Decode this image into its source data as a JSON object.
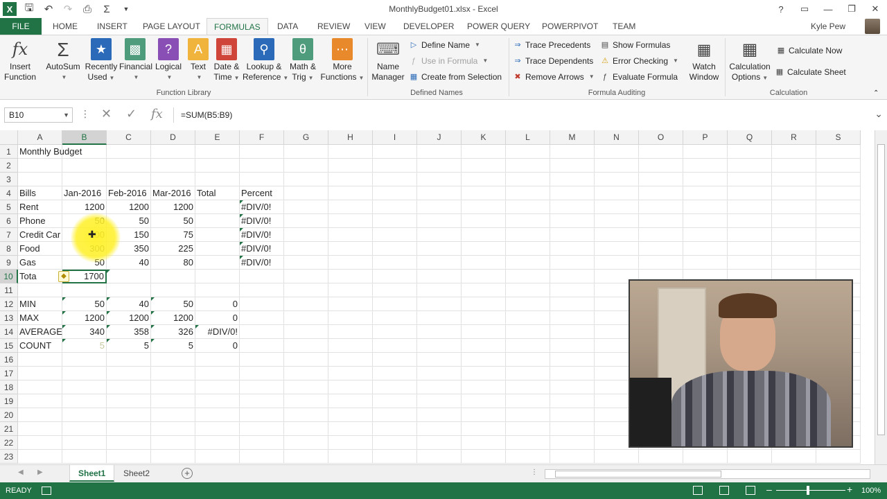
{
  "window": {
    "title": "MonthlyBudget01.xlsx - Excel",
    "app_icon": "X",
    "help_icon": "?"
  },
  "tabs": [
    {
      "label": "FILE"
    },
    {
      "label": "HOME"
    },
    {
      "label": "INSERT"
    },
    {
      "label": "PAGE LAYOUT"
    },
    {
      "label": "FORMULAS"
    },
    {
      "label": "DATA"
    },
    {
      "label": "REVIEW"
    },
    {
      "label": "VIEW"
    },
    {
      "label": "DEVELOPER"
    },
    {
      "label": "POWER QUERY"
    },
    {
      "label": "POWERPIVOT"
    },
    {
      "label": "TEAM"
    }
  ],
  "active_tab": "FORMULAS",
  "user": {
    "name": "Kyle Pew"
  },
  "ribbon": {
    "function_library": {
      "label": "Function Library",
      "insert_function": "Insert\nFunction",
      "autosum": "AutoSum",
      "recently_used_1": "Recently",
      "recently_used_2": "Used",
      "financial": "Financial",
      "logical": "Logical",
      "text": "Text",
      "date_time_1": "Date &",
      "date_time_2": "Time",
      "lookup_1": "Lookup &",
      "lookup_2": "Reference",
      "math_1": "Math &",
      "math_2": "Trig",
      "more_1": "More",
      "more_2": "Functions"
    },
    "defined_names": {
      "label": "Defined Names",
      "name_manager_1": "Name",
      "name_manager_2": "Manager",
      "define_name": "Define Name",
      "use_in_formula": "Use in Formula",
      "create_from_selection": "Create from Selection"
    },
    "formula_auditing": {
      "label": "Formula Auditing",
      "trace_precedents": "Trace Precedents",
      "trace_dependents": "Trace Dependents",
      "remove_arrows": "Remove Arrows",
      "show_formulas": "Show Formulas",
      "error_checking": "Error Checking",
      "evaluate_formula": "Evaluate Formula",
      "watch_window_1": "Watch",
      "watch_window_2": "Window"
    },
    "calculation": {
      "label": "Calculation",
      "calc_options_1": "Calculation",
      "calc_options_2": "Options",
      "calculate_now": "Calculate Now",
      "calculate_sheet": "Calculate Sheet"
    },
    "colors": {
      "accent": "#217346"
    }
  },
  "formula_bar": {
    "name_box": "B10",
    "formula": "=SUM(B5:B9)"
  },
  "columns": [
    "A",
    "B",
    "C",
    "D",
    "E",
    "F",
    "G",
    "H",
    "I",
    "J",
    "K",
    "L",
    "M",
    "N",
    "O",
    "P",
    "Q",
    "R",
    "S"
  ],
  "selected_column": "B",
  "rows": [
    "1",
    "2",
    "3",
    "4",
    "5",
    "6",
    "7",
    "8",
    "9",
    "10",
    "11",
    "12",
    "13",
    "14",
    "15",
    "16",
    "17",
    "18",
    "19",
    "20",
    "21",
    "22",
    "23"
  ],
  "selected_row": "10",
  "cells": {
    "A1": "Monthly Budget",
    "A4": "Bills",
    "B4": "Jan-2016",
    "C4": "Feb-2016",
    "D4": "Mar-2016",
    "E4": "Total",
    "F4": "Percent",
    "A5": "Rent",
    "B5": "1200",
    "C5": "1200",
    "D5": "1200",
    "F5": "#DIV/0!",
    "A6": "Phone",
    "B6": "50",
    "C6": "50",
    "D6": "50",
    "F6": "#DIV/0!",
    "A7": "Credit Car",
    "B7": "100",
    "C7": "150",
    "D7": "75",
    "F7": "#DIV/0!",
    "A8": "Food",
    "B8": "300",
    "C8": "350",
    "D8": "225",
    "F8": "#DIV/0!",
    "A9": "Gas",
    "B9": "50",
    "C9": "40",
    "D9": "80",
    "F9": "#DIV/0!",
    "A10": "Tota",
    "B10": "1700",
    "A12": "MIN",
    "B12": "50",
    "C12": "40",
    "D12": "50",
    "E12": "0",
    "A13": "MAX",
    "B13": "1200",
    "C13": "1200",
    "D13": "1200",
    "E13": "0",
    "A14": "AVERAGE",
    "B14": "340",
    "C14": "358",
    "D14": "326",
    "E14": "#DIV/0!",
    "A15": "COUNT",
    "B15": "5",
    "C15": "5",
    "D15": "5",
    "E15": "0"
  },
  "sheets": [
    {
      "label": "Sheet1",
      "active": true
    },
    {
      "label": "Sheet2",
      "active": false
    }
  ],
  "status": {
    "ready": "READY",
    "zoom": "100%"
  }
}
